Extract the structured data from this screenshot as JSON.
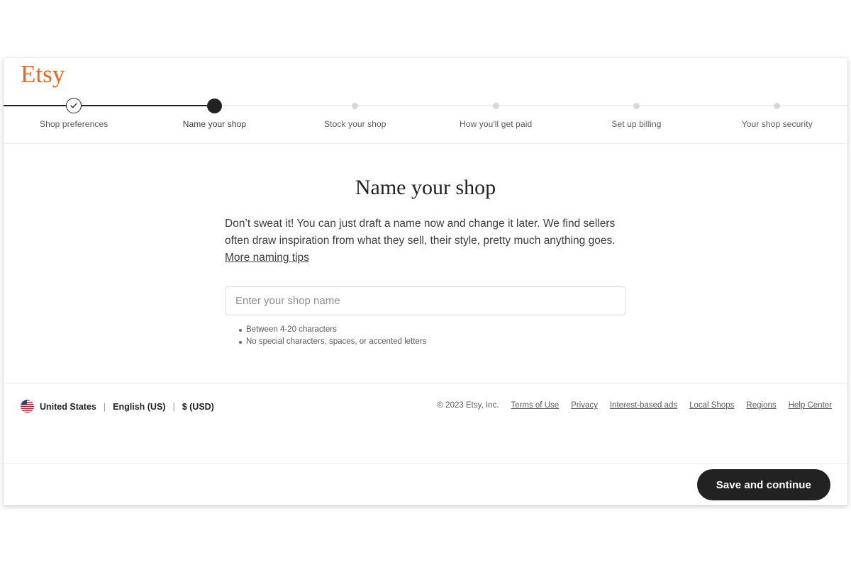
{
  "brand": {
    "logo_text": "Etsy",
    "logo_color": "#f1641e"
  },
  "stepper": {
    "steps": [
      {
        "label": "Shop preferences",
        "state": "complete"
      },
      {
        "label": "Name your shop",
        "state": "active"
      },
      {
        "label": "Stock your shop",
        "state": "todo"
      },
      {
        "label": "How you'll get paid",
        "state": "todo"
      },
      {
        "label": "Set up billing",
        "state": "todo"
      },
      {
        "label": "Your shop security",
        "state": "todo"
      }
    ]
  },
  "main": {
    "title": "Name your shop",
    "intro_text": "Don’t sweat it! You can just draft a name now and change it later. We find sellers often draw inspiration from what they sell, their style, pretty much anything goes. ",
    "intro_link": "More naming tips",
    "shop_name_value": "",
    "shop_name_placeholder": "Enter your shop name",
    "hints": [
      "Between 4-20 characters",
      "No special characters, spaces, or accented letters"
    ]
  },
  "footer": {
    "country": "United States",
    "language": "English (US)",
    "currency": "$ (USD)",
    "separator": "|",
    "copyright": "© 2023 Etsy, Inc.",
    "links": [
      "Terms of Use",
      "Privacy",
      "Interest-based ads",
      "Local Shops",
      "Regions",
      "Help Center"
    ]
  },
  "actions": {
    "primary_label": "Save and continue"
  },
  "colors": {
    "accent": "#f1641e",
    "ink": "#222222",
    "muted": "#595959",
    "line": "#efefef"
  }
}
